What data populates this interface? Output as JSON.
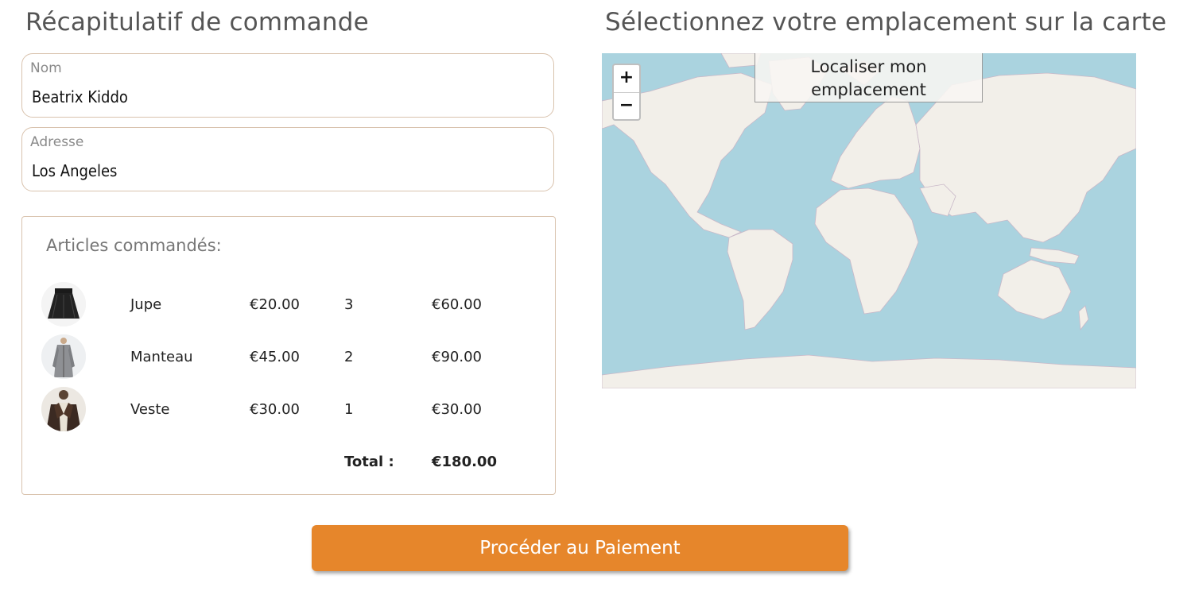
{
  "left": {
    "title": "Récapitulatif de commande",
    "name_label": "Nom",
    "name_value": "Beatrix Kiddo",
    "address_label": "Adresse",
    "address_value": "Los Angeles"
  },
  "articles": {
    "title": "Articles commandés:",
    "items": [
      {
        "name": "Jupe",
        "price": "€20.00",
        "qty": "3",
        "subtotal": "€60.00",
        "image": "black-pleated-skirt"
      },
      {
        "name": "Manteau",
        "price": "€45.00",
        "qty": "2",
        "subtotal": "€90.00",
        "image": "grey-long-coat"
      },
      {
        "name": "Veste",
        "price": "€30.00",
        "qty": "1",
        "subtotal": "€30.00",
        "image": "brown-leather-jacket"
      }
    ],
    "total_label": "Total :",
    "total_value": "€180.00"
  },
  "right": {
    "title": "Sélectionnez votre emplacement sur la carte",
    "zoom_in": "+",
    "zoom_out": "−",
    "locate_line1": "Localiser mon",
    "locate_line2": "emplacement",
    "map_colors": {
      "ocean": "#aad3df",
      "land": "#f2efe9",
      "borders": "#c9b8c8"
    }
  },
  "pay_button": "Procéder au Paiement",
  "colors": {
    "accent": "#e6862b",
    "border": "#d9c3ae"
  }
}
